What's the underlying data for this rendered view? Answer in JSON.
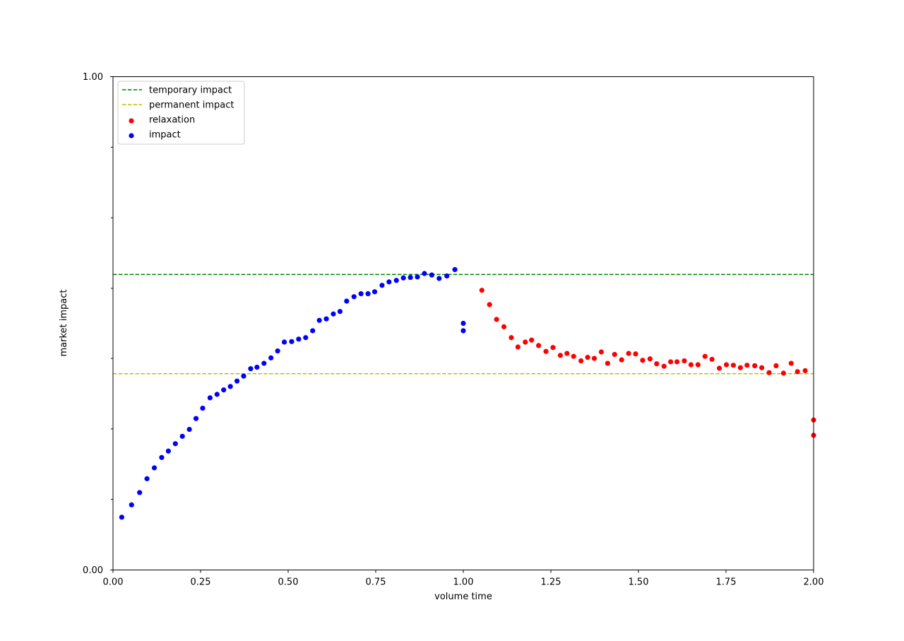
{
  "chart_data": {
    "type": "scatter",
    "title": "",
    "xlabel": "volume time",
    "ylabel": "market impact",
    "xlim": [
      0,
      2
    ],
    "ylim": [
      0,
      1
    ],
    "x_ticks": [
      "0.00",
      "0.25",
      "0.50",
      "0.75",
      "1.00",
      "1.25",
      "1.50",
      "1.75",
      "2.00"
    ],
    "y_ticks": [
      "0.00",
      "1.00"
    ],
    "y_minor_ticks": [
      0.143,
      0.286,
      0.429,
      0.571,
      0.714,
      0.857
    ],
    "grid": false,
    "legend_position": "top-left",
    "lines": [
      {
        "name": "temporary impact",
        "y": 0.599,
        "color": "#008000",
        "style": "dashed"
      },
      {
        "name": "permanent impact",
        "y": 0.398,
        "color": "#bfbf00",
        "style": "dashed"
      }
    ],
    "series": [
      {
        "name": "relaxation",
        "color": "#ff0000",
        "x": [
          1.053,
          1.075,
          1.095,
          1.116,
          1.137,
          1.156,
          1.177,
          1.195,
          1.215,
          1.236,
          1.256,
          1.277,
          1.296,
          1.315,
          1.336,
          1.355,
          1.374,
          1.394,
          1.412,
          1.432,
          1.452,
          1.472,
          1.492,
          1.512,
          1.533,
          1.552,
          1.573,
          1.592,
          1.61,
          1.631,
          1.65,
          1.67,
          1.69,
          1.71,
          1.731,
          1.751,
          1.771,
          1.791,
          1.81,
          1.832,
          1.852,
          1.873,
          1.893,
          1.914,
          1.936,
          1.954,
          1.976,
          2.0,
          2.0
        ],
        "y": [
          0.567,
          0.538,
          0.508,
          0.493,
          0.471,
          0.452,
          0.462,
          0.466,
          0.455,
          0.443,
          0.451,
          0.435,
          0.439,
          0.433,
          0.424,
          0.431,
          0.429,
          0.442,
          0.419,
          0.437,
          0.426,
          0.439,
          0.438,
          0.425,
          0.428,
          0.418,
          0.413,
          0.422,
          0.422,
          0.424,
          0.416,
          0.416,
          0.433,
          0.427,
          0.409,
          0.416,
          0.415,
          0.41,
          0.415,
          0.414,
          0.41,
          0.4,
          0.414,
          0.399,
          0.419,
          0.402,
          0.404,
          0.304,
          0.273
        ]
      },
      {
        "name": "impact",
        "color": "#0000ff",
        "x": [
          0.025,
          0.053,
          0.076,
          0.097,
          0.118,
          0.139,
          0.158,
          0.178,
          0.198,
          0.218,
          0.237,
          0.256,
          0.277,
          0.297,
          0.316,
          0.335,
          0.354,
          0.373,
          0.393,
          0.411,
          0.431,
          0.451,
          0.47,
          0.489,
          0.51,
          0.53,
          0.55,
          0.57,
          0.589,
          0.609,
          0.629,
          0.648,
          0.667,
          0.688,
          0.708,
          0.728,
          0.747,
          0.768,
          0.788,
          0.809,
          0.829,
          0.849,
          0.869,
          0.889,
          0.91,
          0.931,
          0.953,
          0.976,
          1.0,
          1.0
        ],
        "y": [
          0.107,
          0.132,
          0.157,
          0.185,
          0.207,
          0.228,
          0.241,
          0.256,
          0.271,
          0.285,
          0.307,
          0.328,
          0.349,
          0.356,
          0.365,
          0.372,
          0.383,
          0.393,
          0.408,
          0.411,
          0.419,
          0.43,
          0.444,
          0.462,
          0.463,
          0.468,
          0.471,
          0.485,
          0.506,
          0.509,
          0.519,
          0.524,
          0.545,
          0.554,
          0.56,
          0.56,
          0.564,
          0.577,
          0.584,
          0.587,
          0.592,
          0.593,
          0.594,
          0.601,
          0.598,
          0.591,
          0.596,
          0.609,
          0.5,
          0.485
        ]
      }
    ]
  }
}
